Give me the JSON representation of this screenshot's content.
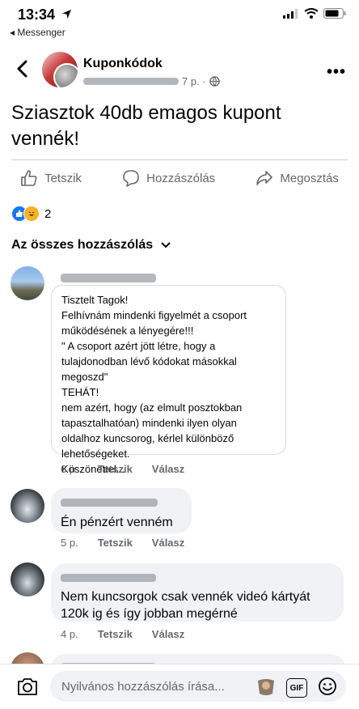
{
  "status_bar": {
    "time": "13:34",
    "back_app": "◂ Messenger"
  },
  "post": {
    "group_name": "Kuponkódok",
    "time": "7 p. ·",
    "text": "Sziasztok 40db emagos kupont vennék!",
    "actions": {
      "like": "Tetszik",
      "comment": "Hozzászólás",
      "share": "Megosztás"
    },
    "reaction_count": "2"
  },
  "comments_sort": {
    "label": "Az összes hozzászólás"
  },
  "comments": [
    {
      "text": "Tisztelt Tagok!\nFelhívnám mindenki figyelmét a csoport működésének a lényegére!!!\n\" A csoport azért jött létre, hogy a tulajdonodban lévő kódokat másokkal megoszd\"\nTEHÁT!\nnem azért, hogy (az elmult posztokban tapasztalhatóan) mindenki ilyen olyan oldalhoz kuncsorog, kérlel különböző lehetőségeket.\nKöszönettel...",
      "time": "6 p.",
      "like": "Tetszik",
      "reply": "Válasz"
    },
    {
      "text": "Én pénzért venném",
      "time": "5 p.",
      "like": "Tetszik",
      "reply": "Válasz"
    },
    {
      "text": "Nem kuncsorgok csak vennék videó kártyát 120k ig és így jobban megérné",
      "time": "4 p.",
      "like": "Tetszik",
      "reply": "Válasz"
    }
  ],
  "composer": {
    "placeholder": "Nyilvános hozzászólás írása...",
    "gif_label": "GIF"
  },
  "colors": {
    "facebook_blue": "#1877f2",
    "secondary_text": "#65676b",
    "bubble": "#f0f2f5"
  }
}
